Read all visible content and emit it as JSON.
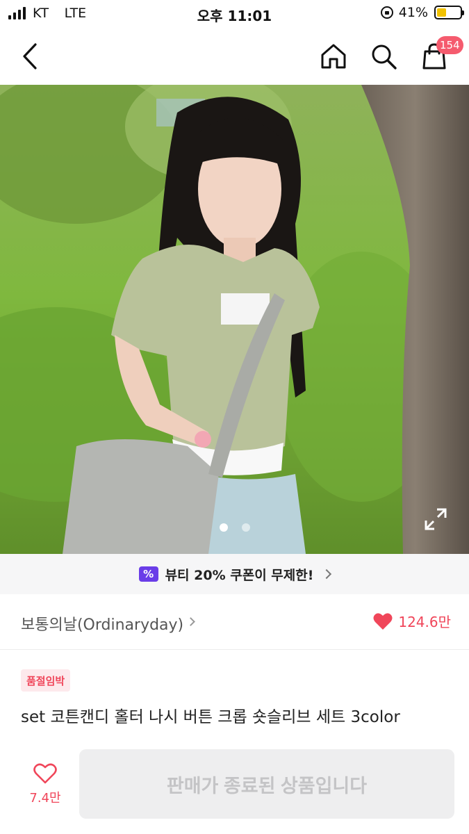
{
  "status_bar": {
    "carrier": "KT",
    "network": "LTE",
    "time": "오후 11:01",
    "battery": "41%",
    "battery_level": 0.41,
    "icons": [
      "signal-icon",
      "orientation-lock-icon",
      "battery-icon"
    ]
  },
  "nav": {
    "icons": [
      "back-arrow-icon",
      "home-icon",
      "search-icon",
      "shopping-bag-icon"
    ],
    "cart_count": "154"
  },
  "gallery": {
    "image_count": 2,
    "active_index": 0,
    "icons": [
      "expand-icon"
    ]
  },
  "coupon": {
    "icon_label": "%",
    "text": "뷰티 20% 쿠폰이 무제한!"
  },
  "store": {
    "name": "보통의날(Ordinaryday)",
    "like_count": "124.6만",
    "icons": [
      "chevron-right-icon",
      "heart-filled-icon"
    ]
  },
  "product": {
    "badge": "품절임박",
    "title": "set 코튼캔디 홀터 나시 버튼 크롭 숏슬리브 세트 3color"
  },
  "bottom_bar": {
    "like_count": "7.4만",
    "cta_label": "판매가 종료된 상품입니다",
    "icons": [
      "heart-outline-icon"
    ]
  },
  "colors": {
    "accent": "#f0465a",
    "badge_bg": "#fde9ec",
    "coupon_icon": "#6a3de8",
    "cta_bg": "#eeeeef",
    "cta_text": "#c4c4c6",
    "battery": "#f2c200"
  }
}
